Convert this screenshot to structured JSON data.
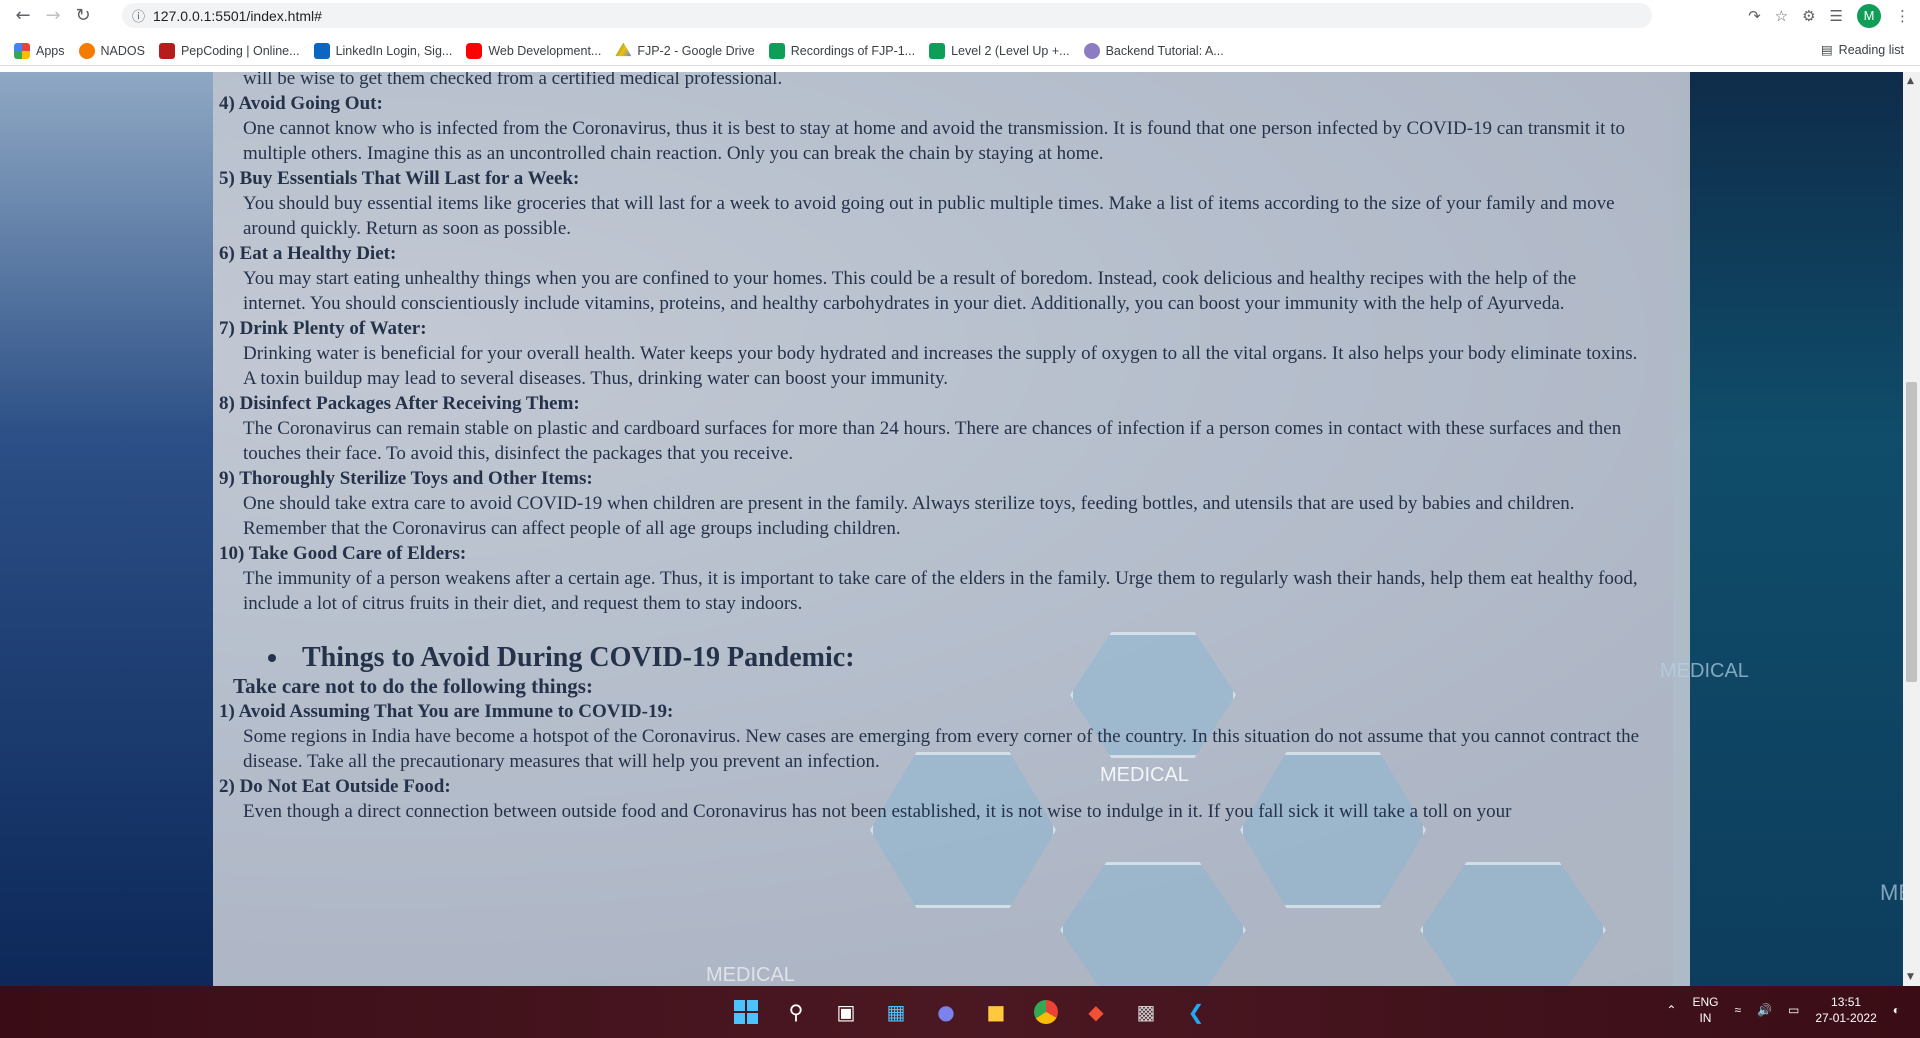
{
  "browser": {
    "url": "127.0.0.1:5501/index.html#",
    "profile_initial": "M",
    "bookmarks": [
      "Apps",
      "NADOS",
      "PepCoding | Online...",
      "LinkedIn Login, Sig...",
      "Web Development...",
      "FJP-2 - Google Drive",
      "Recordings of FJP-1...",
      "Level 2 (Level Up +...",
      "Backend Tutorial: A..."
    ],
    "reading_list": "Reading list"
  },
  "article": {
    "lead_tail": "will be wise to get them checked from a certified medical professional.",
    "tips": [
      {
        "title": "4) Avoid Going Out:",
        "body": "One cannot know who is infected from the Coronavirus, thus it is best to stay at home and avoid the transmission. It is found that one person infected by COVID-19 can transmit it to multiple others. Imagine this as an uncontrolled chain reaction. Only you can break the chain by staying at home."
      },
      {
        "title": "5) Buy Essentials That Will Last for a Week:",
        "body": "You should buy essential items like groceries that will last for a week to avoid going out in public multiple times. Make a list of items according to the size of your family and move around quickly. Return as soon as possible."
      },
      {
        "title": "6) Eat a Healthy Diet:",
        "body": "You may start eating unhealthy things when you are confined to your homes. This could be a result of boredom. Instead, cook delicious and healthy recipes with the help of the internet. You should conscientiously include vitamins, proteins, and healthy carbohydrates in your diet. Additionally, you can boost your immunity with the help of Ayurveda."
      },
      {
        "title": "7) Drink Plenty of Water:",
        "body": "Drinking water is beneficial for your overall health. Water keeps your body hydrated and increases the supply of oxygen to all the vital organs. It also helps your body eliminate toxins. A toxin buildup may lead to several diseases. Thus, drinking water can boost your immunity."
      },
      {
        "title": "8) Disinfect Packages After Receiving Them:",
        "body": "The Coronavirus can remain stable on plastic and cardboard surfaces for more than 24 hours. There are chances of infection if a person comes in contact with these surfaces and then touches their face. To avoid this, disinfect the packages that you receive."
      },
      {
        "title": "9) Thoroughly Sterilize Toys and Other Items:",
        "body": "One should take extra care to avoid COVID-19 when children are present in the family. Always sterilize toys, feeding bottles, and utensils that are used by babies and children. Remember that the Coronavirus can affect people of all age groups including children."
      },
      {
        "title": "10) Take Good Care of Elders:",
        "body": "The immunity of a person weakens after a certain age. Thus, it is important to take care of the elders in the family. Urge them to regularly wash their hands, help them eat healthy food, include a lot of citrus fruits in their diet, and request them to stay indoors."
      }
    ],
    "section_heading": "Things to Avoid During COVID-19 Pandemic:",
    "section_sub": "Take care not to do the following things:",
    "avoid": [
      {
        "title": "1) Avoid Assuming That You are Immune to COVID-19:",
        "body": "Some regions in India have become a hotspot of the Coronavirus. New cases are emerging from every corner of the country. In this situation do not assume that you cannot contract the disease. Take all the precautionary measures that will help you prevent an infection."
      },
      {
        "title": "2) Do Not Eat Outside Food:",
        "body": "Even though a direct connection between outside food and Coronavirus has not been established, it is not wise to indulge in it. If you fall sick it will take a toll on your"
      }
    ],
    "bg_labels": [
      "MEDICAL",
      "MEDICAL",
      "MEDICAL",
      "MED"
    ]
  },
  "taskbar": {
    "lang_top": "ENG",
    "lang_bottom": "IN",
    "time": "13:51",
    "date": "27-01-2022"
  }
}
